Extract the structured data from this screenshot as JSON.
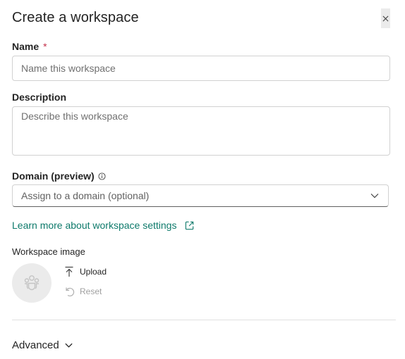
{
  "dialog": {
    "title": "Create a workspace",
    "close_icon": "close-icon"
  },
  "name": {
    "label": "Name",
    "required_mark": "*",
    "placeholder": "Name this workspace",
    "value": ""
  },
  "description": {
    "label": "Description",
    "placeholder": "Describe this workspace",
    "value": ""
  },
  "domain": {
    "label": "Domain (preview)",
    "info_icon": "info-icon",
    "selected_text": "Assign to a domain (optional)",
    "chevron_icon": "chevron-down-icon"
  },
  "learn_more": {
    "label": "Learn more about workspace settings",
    "icon": "open-in-new-icon"
  },
  "workspace_image": {
    "label": "Workspace image",
    "avatar_icon": "people-group-icon",
    "upload_label": "Upload",
    "upload_icon": "upload-arrow-icon",
    "reset_label": "Reset",
    "reset_icon": "reset-arrow-icon"
  },
  "advanced": {
    "label": "Advanced",
    "chevron_icon": "chevron-down-icon"
  },
  "colors": {
    "link": "#0e7a6b",
    "required": "#c4314b",
    "border": "#d1d1d1",
    "avatar_bg": "#ebebeb"
  }
}
